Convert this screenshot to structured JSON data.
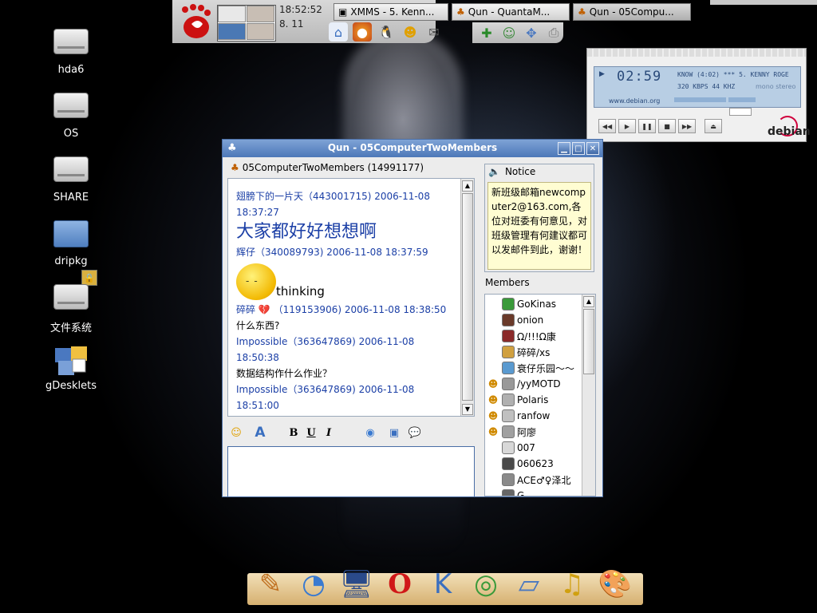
{
  "desktop": {
    "icons": [
      {
        "label": "hda6",
        "icon": "hard-drive-icon"
      },
      {
        "label": "OS",
        "icon": "hard-drive-icon"
      },
      {
        "label": "SHARE",
        "icon": "hard-drive-icon"
      },
      {
        "label": "dripkg",
        "icon": "folder-icon"
      },
      {
        "label": "文件系统",
        "icon": "hard-drive-icon"
      },
      {
        "label": "gDesklets",
        "icon": "puzzle-icon"
      }
    ]
  },
  "panel": {
    "clock_time": "18:52:52",
    "clock_date": "8. 11",
    "quick_launch": [
      "home-icon",
      "firefox-icon",
      "qq-penguin-icon",
      "user-icon",
      "mail-icon"
    ],
    "tasks": [
      {
        "label": "XMMS - 5. Kenn...",
        "icon": "xmms-icon"
      },
      {
        "label": "Qun - QuantaM...",
        "icon": "qq-group-icon"
      },
      {
        "label": "Qun - 05Compu...",
        "icon": "qq-group-icon"
      }
    ]
  },
  "xmms": {
    "time": "02:59",
    "marquee": "KNOW (4:02)  ***  5. KENNY ROGE",
    "bitrate": "320 KBPS  44 KHZ",
    "mode_mono": "mono",
    "mode_stereo": "stereo",
    "url": "www.debian.org",
    "logo": "debian",
    "controls": [
      "previous-icon",
      "play-icon",
      "pause-icon",
      "stop-icon",
      "next-icon",
      "eject-icon"
    ]
  },
  "qun": {
    "window_title": "Qun - 05ComputerTwoMembers",
    "group_name": "05ComputerTwoMembers (14991177)",
    "messages": [
      {
        "sender": "翅膀下的一片天（443001715) 2006-11-08 18:37:27",
        "text": "大家都好好想想啊",
        "big": true
      },
      {
        "sender": "辉仔（340089793) 2006-11-08 18:37:59",
        "emoticon": "smiley-thinking-icon",
        "text": "thinking"
      },
      {
        "sender": "碎碎",
        "sender_icon": "broken-heart-icon",
        "sender_rest": "（119153906) 2006-11-08 18:38:50",
        "text": "什么东西?"
      },
      {
        "sender": "Impossible（363647869) 2006-11-08 18:50:38",
        "text": "数据结构作什么作业？"
      },
      {
        "sender": "Impossible（363647869) 2006-11-08 18:51:00",
        "text": ""
      }
    ],
    "notice_title": "Notice",
    "notice_text": "新班级邮箱newcomputer2@163.com,各位对班委有何意见，对班级管理有何建议都可以发邮件到此，谢谢！",
    "members_label": "Members",
    "members": [
      {
        "name": "GoKinas",
        "status": "",
        "avatar_color": "#3a9a3a"
      },
      {
        "name": "onion",
        "status": "",
        "avatar_color": "#6a3a2a"
      },
      {
        "name": "Ω/!!!Ω康",
        "status": "",
        "avatar_color": "#8a2a2a"
      },
      {
        "name": "碎碎/xs",
        "status": "",
        "avatar_color": "#d0a040"
      },
      {
        "name": "衰仔乐园～～",
        "status": "",
        "avatar_color": "#5a9ad0"
      },
      {
        "name": "/yyMOTD",
        "status": "online",
        "avatar_color": "#999999"
      },
      {
        "name": "Polaris",
        "status": "online",
        "avatar_color": "#b0b0b0"
      },
      {
        "name": "ranfow",
        "status": "online",
        "avatar_color": "#c0c0c0"
      },
      {
        "name": "阿廖",
        "status": "online",
        "avatar_color": "#a0a0a0"
      },
      {
        "name": "007",
        "status": "",
        "avatar_color": "#d8d8d8"
      },
      {
        "name": "060623",
        "status": "",
        "avatar_color": "#4a4a4a"
      },
      {
        "name": "ACE♂♀泽北",
        "status": "",
        "avatar_color": "#8a8a8a"
      },
      {
        "name": "G...",
        "status": "",
        "avatar_color": "#666666"
      }
    ],
    "toolbar": [
      "smiley-icon",
      "font-icon",
      "bold-icon",
      "underline-icon",
      "italic-icon",
      "color-icon",
      "screenshot-icon",
      "chat-bubble-icon"
    ],
    "bold_label": "B",
    "underline_label": "U",
    "italic_label": "I",
    "font_label": "A"
  },
  "dock": {
    "items": [
      "text-editor-icon",
      "fish-browser-icon",
      "monitor-icon",
      "opera-icon",
      "kde-icon",
      "media-player-icon",
      "image-viewer-icon",
      "music-note-icon",
      "paint-palette-icon"
    ]
  },
  "colors": {
    "titlebar": "#5b84c2",
    "sender_blue": "#1b3fa6",
    "notice_bg": "#fffdd2",
    "dock_bg": "#e0c080"
  }
}
